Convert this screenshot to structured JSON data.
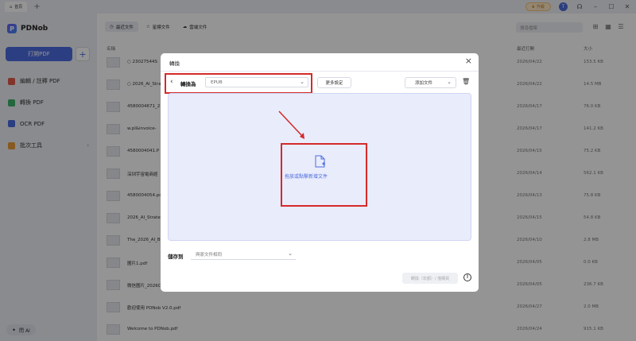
{
  "titlebar": {
    "tab_label": "首頁",
    "upgrade_label": "升級",
    "avatar_initial": "T",
    "win_controls": [
      "–",
      "☐",
      "✕"
    ]
  },
  "sidebar": {
    "app_name": "PDNob",
    "logo_mark": "P",
    "open_pdf_label": "打開PDF",
    "plus_label": "+",
    "items": [
      {
        "label": "編輯 / 註釋 PDF",
        "icon": "edit-icon",
        "color": "#e05a4d"
      },
      {
        "label": "轉換 PDF",
        "icon": "convert-icon",
        "color": "#3fb26b"
      },
      {
        "label": "OCR PDF",
        "icon": "ocr-icon",
        "color": "#4d6ce0"
      },
      {
        "label": "批次工具",
        "icon": "batch-icon",
        "color": "#e89b3a"
      }
    ],
    "ai_label": "問 AI"
  },
  "main": {
    "tabs": [
      {
        "label": "最近文件",
        "icon": "clock-icon"
      },
      {
        "label": "星標文件",
        "icon": "star-icon"
      },
      {
        "label": "雲端文件",
        "icon": "cloud-icon"
      }
    ],
    "search_placeholder": "搜尋檔案",
    "columns": {
      "name": "名稱",
      "date": "最近打開",
      "size": "大小"
    },
    "rows": [
      {
        "name": "○ 23027544S",
        "date": "2026/04/22",
        "size": "153.5 KB"
      },
      {
        "name": "○ 2026_AI_Stra",
        "date": "2026/04/22",
        "size": "14.5 MB"
      },
      {
        "name": "4580004671_2",
        "date": "2026/04/17",
        "size": "76.0 KB"
      },
      {
        "name": "w.pl&invoice-",
        "date": "2026/04/17",
        "size": "141.2 KB"
      },
      {
        "name": "4580004041.P",
        "date": "2026/04/15",
        "size": "75.2 KB"
      },
      {
        "name": "深圳宇宙電商經",
        "date": "2026/04/14",
        "size": "562.1 KB"
      },
      {
        "name": "4580004054.pd",
        "date": "2026/04/13",
        "size": "75.8 KB"
      },
      {
        "name": "2026_AI_Strate",
        "date": "2026/04/15",
        "size": "54.8 KB"
      },
      {
        "name": "The_2026_AI_B",
        "date": "2026/04/10",
        "size": "2.8 MB"
      },
      {
        "name": "圖片1.pdf",
        "date": "2026/04/05",
        "size": "0.0 KB"
      },
      {
        "name": "微信圖片_2026C",
        "date": "2026/04/05",
        "size": "236.7 KB"
      },
      {
        "name": "歡迎使用 PDNob V2.0.pdf",
        "date": "2026/04/27",
        "size": "2.0 MB"
      },
      {
        "name": "Welcome to PDNob.pdf",
        "date": "2026/04/24",
        "size": "915.1 KB"
      }
    ]
  },
  "dialog": {
    "title": "轉換",
    "convert_to_label": "轉換為",
    "format_value": "EPUB",
    "more_settings_label": "更多設定",
    "add_file_label": "添加文件",
    "drop_text": "拖放或點擊新增文件",
    "save_to_label": "儲存到",
    "save_to_value": "與原文件相同",
    "convert_button_label": "轉換（非額）/ 僅購買",
    "highlight_color": "#d42a2a",
    "accent_color": "#4d6ce0"
  }
}
